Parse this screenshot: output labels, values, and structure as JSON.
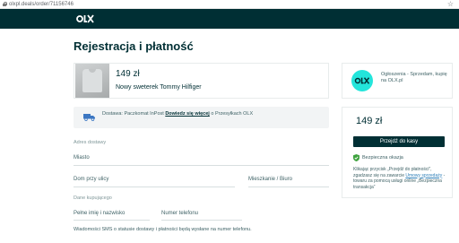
{
  "browser": {
    "url": "olxpl.deals/order/71156746"
  },
  "header": {
    "logo_text": "OLX"
  },
  "page": {
    "title": "Rejestracja i płatność"
  },
  "product": {
    "price": "149 zł",
    "name": "Nowy sweterek Tommy Hilfiger"
  },
  "seller": {
    "description": "Ogłoszenia - Sprzedam, kupię na OLX.pl"
  },
  "delivery": {
    "prefix": "Dostawa: Paczkomat InPost",
    "link_label": "Dowiedz się więcej",
    "suffix": "o Przesyłkach OLX"
  },
  "form": {
    "address_section": "Adres dostawy",
    "city_label": "Miasto",
    "street_label": "Dom przy ulicy",
    "apartment_label": "Mieszkanie / Biuro",
    "buyer_section": "Dane kupującego",
    "name_label": "Pełne imię i nazwisko",
    "phone_label": "Numer telefonu",
    "sms_note": "Wiadomości SMS o statusie dostawy i płatności będą wysłane na numer telefonu."
  },
  "summary": {
    "price": "149 zł",
    "cta_label": "Przejdź do kasy",
    "safe_label": "Bezpieczna okazja",
    "description_start": "Klikając przycisk „Przejdź do płatności”, zgadzasz się na zawarcie",
    "description_link": "Umowy sprzedaży",
    "description_end": "- towaru za pomocą usługi online „Bezpieczna transakcja”"
  },
  "colors": {
    "brand_dark": "#002f34",
    "brand_cyan": "#23e5db",
    "safe_green": "#3fa33f"
  }
}
